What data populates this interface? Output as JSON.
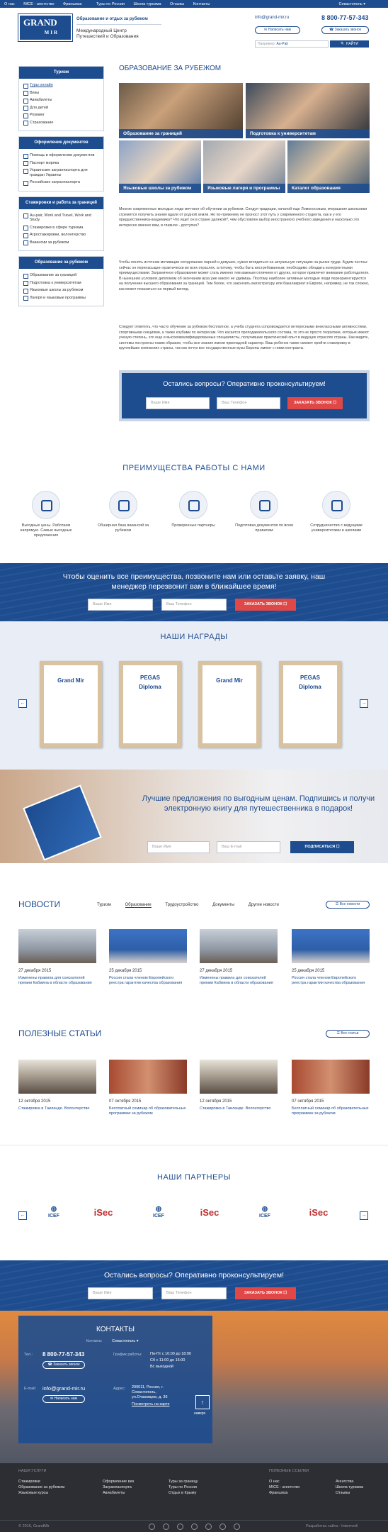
{
  "topnav": {
    "items": [
      "О нас",
      "MICE - агентство",
      "Франшиза",
      "Туры по России",
      "Школа туризма",
      "Отзывы",
      "Контакты"
    ],
    "city": "Севастополь"
  },
  "header": {
    "logo_line1": "GRAND",
    "logo_line2": "MIR",
    "tagline": "Образование и отдых за рубежом",
    "subtitle": "Международный Центр Путешествий и Образования",
    "email": "info@grand-mir.ru",
    "phone": "8 800-77-57-343",
    "write_btn": "Написать нам",
    "call_btn": "Заказать звонок",
    "search_label": "Например:",
    "search_value": "Au-Pair",
    "search_btn": "НАЙТИ"
  },
  "sidebar": [
    {
      "title": "Туризм",
      "items": [
        "Туры онлайн",
        "Визы",
        "Авиабилеты",
        "Для детей",
        "Роуминг",
        "Страхование"
      ]
    },
    {
      "title": "Оформление документов",
      "items": [
        "Помощь в оформлении документов",
        "Паспорт моряка",
        "Украинские загранпаспорта для граждан Украины",
        "Российские загранпаспорта"
      ]
    },
    {
      "title": "Стажировки и работа за границей",
      "items": [
        "Au-pair, Work and Travel, Work and Study",
        "Стажировки в сфере туризма",
        "Агростажировки, волонтерство",
        "Вакансии за рубежом"
      ]
    },
    {
      "title": "Образование за рубежом",
      "items": [
        "Образование за границей",
        "Подготовка к университетам",
        "Языковые школы за рубежом",
        "Лагеря и языковые программы"
      ]
    }
  ],
  "main": {
    "title": "ОБРАЗОВАНИЕ ЗА РУБЕЖОМ",
    "tiles": [
      "Образование за границей",
      "Подготовка к университетам",
      "Языковые школы за рубежом",
      "Языковые лагеря и программы",
      "Каталог образования"
    ],
    "p1": "Многие современные молодые люди мечтают об обучении за рубежом. Следуя традиции, начатой еще Ломоносовым, вчерашние школьники стремятся получить знания вдали от родной земли. Но по-прежнему не проност этот путь у современного студента, как и у его предшественника-академика? Что ищет он в стране далекой?, чем обусловлен выбор иностранного учебного заведения и насколько это интересно именно вам, в главное - доступно?",
    "p2": "Чтобы понять источник мотивации сегодняшних парней и девушек, нужно вглядеться на актуальную ситуацию на рынке труда. Будем честны: сейчас он перенасыщен практически во всех отраслях, а потому, чтобы быть востребованным, необходимо обладать конкурентными преимуществами. Заграничное образование может стать именно тем важным отличием от других, которое привлечет внимание работодателя. В нынешних условиях дипломом об окончании вуза уже никого не удивишь. Поэтому наиболее активные молодые люди переориентируются на получение высшего образования за границей. Тем более, что закончить магистратуру или бакалавриат в Европе, например, не так сложно, как может показаться на первый взгляд.",
    "p3": "Следует отметить, что часто обучение за рубежом бесплатное, а учеба студента сопровождается интересными внеклассными активностями, спортивными секциями, а также клубами по интересам. Что касается преподавательского состава, то это не просто теоретики, которые имеют ученую степень, это еще и высококвалифицированные специалисты, получившие практический опыт в ведущих отраслях страны. Как видите, системы построены таким образом, чтобы все знания имели прикладной характер. Ваш ребенок также сможет пройти стажировку в крупнейших компаниях страны, так как почти все государственные вузы Европы имеют с ними контракты.",
    "cta_title": "Остались вопросы? Оперативно проконсультируем!",
    "name_ph": "Ваше Имя",
    "phone_ph": "Ваш Телефон",
    "order_btn": "ЗАКАЗАТЬ ЗВОНОК"
  },
  "advantages": {
    "title": "ПРЕИМУЩЕСТВА РАБОТЫ С НАМИ",
    "items": [
      "Выгодные цены. Работаем напрямую. Самые выгодные предложения",
      "Обширная база вакансий за рубежом",
      "Проверенные партнеры",
      "Подготовка документов по всем правилам",
      "Сотрудничество с ведущими университетами и школами"
    ]
  },
  "band1": {
    "title": "Чтобы оценить все преимущества, позвоните нам или оставьте заявку, наш менеджер перезвонит вам в ближайшее время!",
    "name_ph": "Ваше Имя",
    "phone_ph": "Ваш Телефон",
    "btn": "ЗАКАЗАТЬ ЗВОНОК"
  },
  "awards": {
    "title": "НАШИ НАГРАДЫ",
    "items": [
      {
        "brand": "",
        "text": "Grand Mir"
      },
      {
        "brand": "PEGAS",
        "text": "Diploma"
      },
      {
        "brand": "",
        "text": "Grand Mir"
      },
      {
        "brand": "PEGAS",
        "text": "Diploma"
      }
    ]
  },
  "promo": {
    "title": "Лучшие предложения по выгодным ценам. Подпишись и получи электронную книгу для путешественника в подарок!",
    "name_ph": "Ваше Имя",
    "mail_ph": "Ваш E-mail",
    "btn": "ПОДПИСАТЬСЯ"
  },
  "news": {
    "title": "НОВОСТИ",
    "tabs": [
      "Туризм",
      "Образование",
      "Трудоустройство",
      "Документы",
      "Другие новости"
    ],
    "all": "Все новости",
    "items": [
      {
        "date": "27 декабря 2015",
        "text": "Изменены правила для соискателей премии Кабмина в области образования"
      },
      {
        "date": "25 декабря 2015",
        "text": "Россия стала членом Европейского реестра гарантии качества образования"
      },
      {
        "date": "27 декабря 2015",
        "text": "Изменены правила для соискателей премии Кабмина в области образования"
      },
      {
        "date": "25 декабря 2015",
        "text": "Россия стала членом Европейского реестра гарантии качества образования"
      }
    ]
  },
  "articles": {
    "title": "ПОЛЕЗНЫЕ СТАТЬИ",
    "all": "Все статьи",
    "items": [
      {
        "date": "12 октября 2015",
        "text": "Стажировка в Таиланде. Волонтерство"
      },
      {
        "date": "07 октября 2015",
        "text": "Бесплатный семинар об образовательных программах за рубежом"
      },
      {
        "date": "12 октября 2015",
        "text": "Стажировка в Таиланде. Волонтерство"
      },
      {
        "date": "07 октября 2015",
        "text": "Бесплатный семинар об образовательных программах за рубежом"
      }
    ]
  },
  "partners": {
    "title": "НАШИ ПАРТНЕРЫ",
    "items": [
      "ICEF",
      "iSec",
      "ICEF",
      "iSec",
      "ICEF",
      "iSec"
    ]
  },
  "band2": {
    "title": "Остались вопросы? Оперативно проконсультируем!",
    "name_ph": "Ваше Имя",
    "phone_ph": "Ваш Телефон",
    "btn": "ЗАКАЗАТЬ ЗВОНОК"
  },
  "contacts": {
    "title": "КОНТАКТЫ",
    "city_label": "Контакты",
    "city": "Севастополь",
    "tel_label": "Тел.:",
    "phone": "8 800-77-57-343",
    "order": "Заказать звонок",
    "sched_label": "График работы:",
    "sched": [
      "Пн-Пт  с 10:00 до 18:00",
      "Сб  с 11:00 до 15:00",
      "Вс  выходной"
    ],
    "mail_label": "E-mail:",
    "email": "info@grand-mir.ru",
    "write": "Написать нам",
    "addr_label": "Адрес:",
    "addr": "299011, Россия, г. Севастополь, ул.Очаковцев, д. 36",
    "map": "Посмотреть на карте",
    "top": "наверх"
  },
  "footer": {
    "col1_title": "НАШИ УСЛУГИ",
    "col1": [
      "Стажировки",
      "Образование за рубежом",
      "Языковые курсы"
    ],
    "col2": [
      "Оформление виз",
      "Загранпаспорта",
      "Авиабилеты"
    ],
    "col3": [
      "Туры за границу",
      "Туры по России",
      "Отдых в Крыму"
    ],
    "col4_title": "ПОЛЕЗНЫЕ ССЫЛКИ",
    "col4": [
      "О нас",
      "MICE - агентство",
      "Франшиза"
    ],
    "col5": [
      "Агентства",
      "Школа туризма",
      "Отзывы"
    ],
    "copy": "© 2016, GrandMir",
    "dev": "Разработка сайта - Intermedi"
  }
}
